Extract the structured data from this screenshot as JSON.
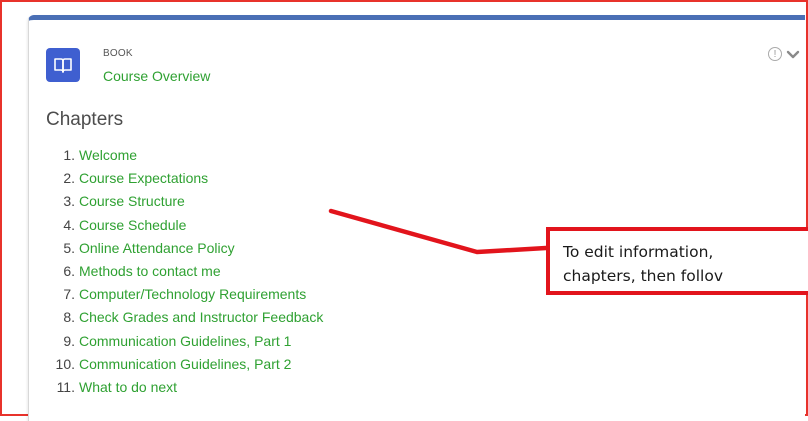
{
  "resource": {
    "type_label": "BOOK",
    "title": "Course Overview",
    "icon": "book-open-icon",
    "accent_color": "#3f5fd0",
    "link_color": "#2fa132"
  },
  "info_icon_glyph": "!",
  "chapters_heading": "Chapters",
  "chapters": [
    {
      "num": "1.",
      "label": "Welcome"
    },
    {
      "num": "2.",
      "label": "Course Expectations"
    },
    {
      "num": "3.",
      "label": "Course Structure"
    },
    {
      "num": "4.",
      "label": "Course Schedule"
    },
    {
      "num": "5.",
      "label": "Online Attendance Policy"
    },
    {
      "num": "6.",
      "label": "Methods to contact me"
    },
    {
      "num": "7.",
      "label": "Computer/Technology Requirements"
    },
    {
      "num": "8.",
      "label": "Check Grades and Instructor Feedback"
    },
    {
      "num": "9.",
      "label": "Communication Guidelines, Part 1"
    },
    {
      "num": "10.",
      "label": "Communication Guidelines, Part 2"
    },
    {
      "num": "11.",
      "label": "What to do next"
    }
  ],
  "callout": {
    "line1": "To edit information,",
    "line2": "chapters, then follov",
    "border_color": "#e2141c"
  }
}
